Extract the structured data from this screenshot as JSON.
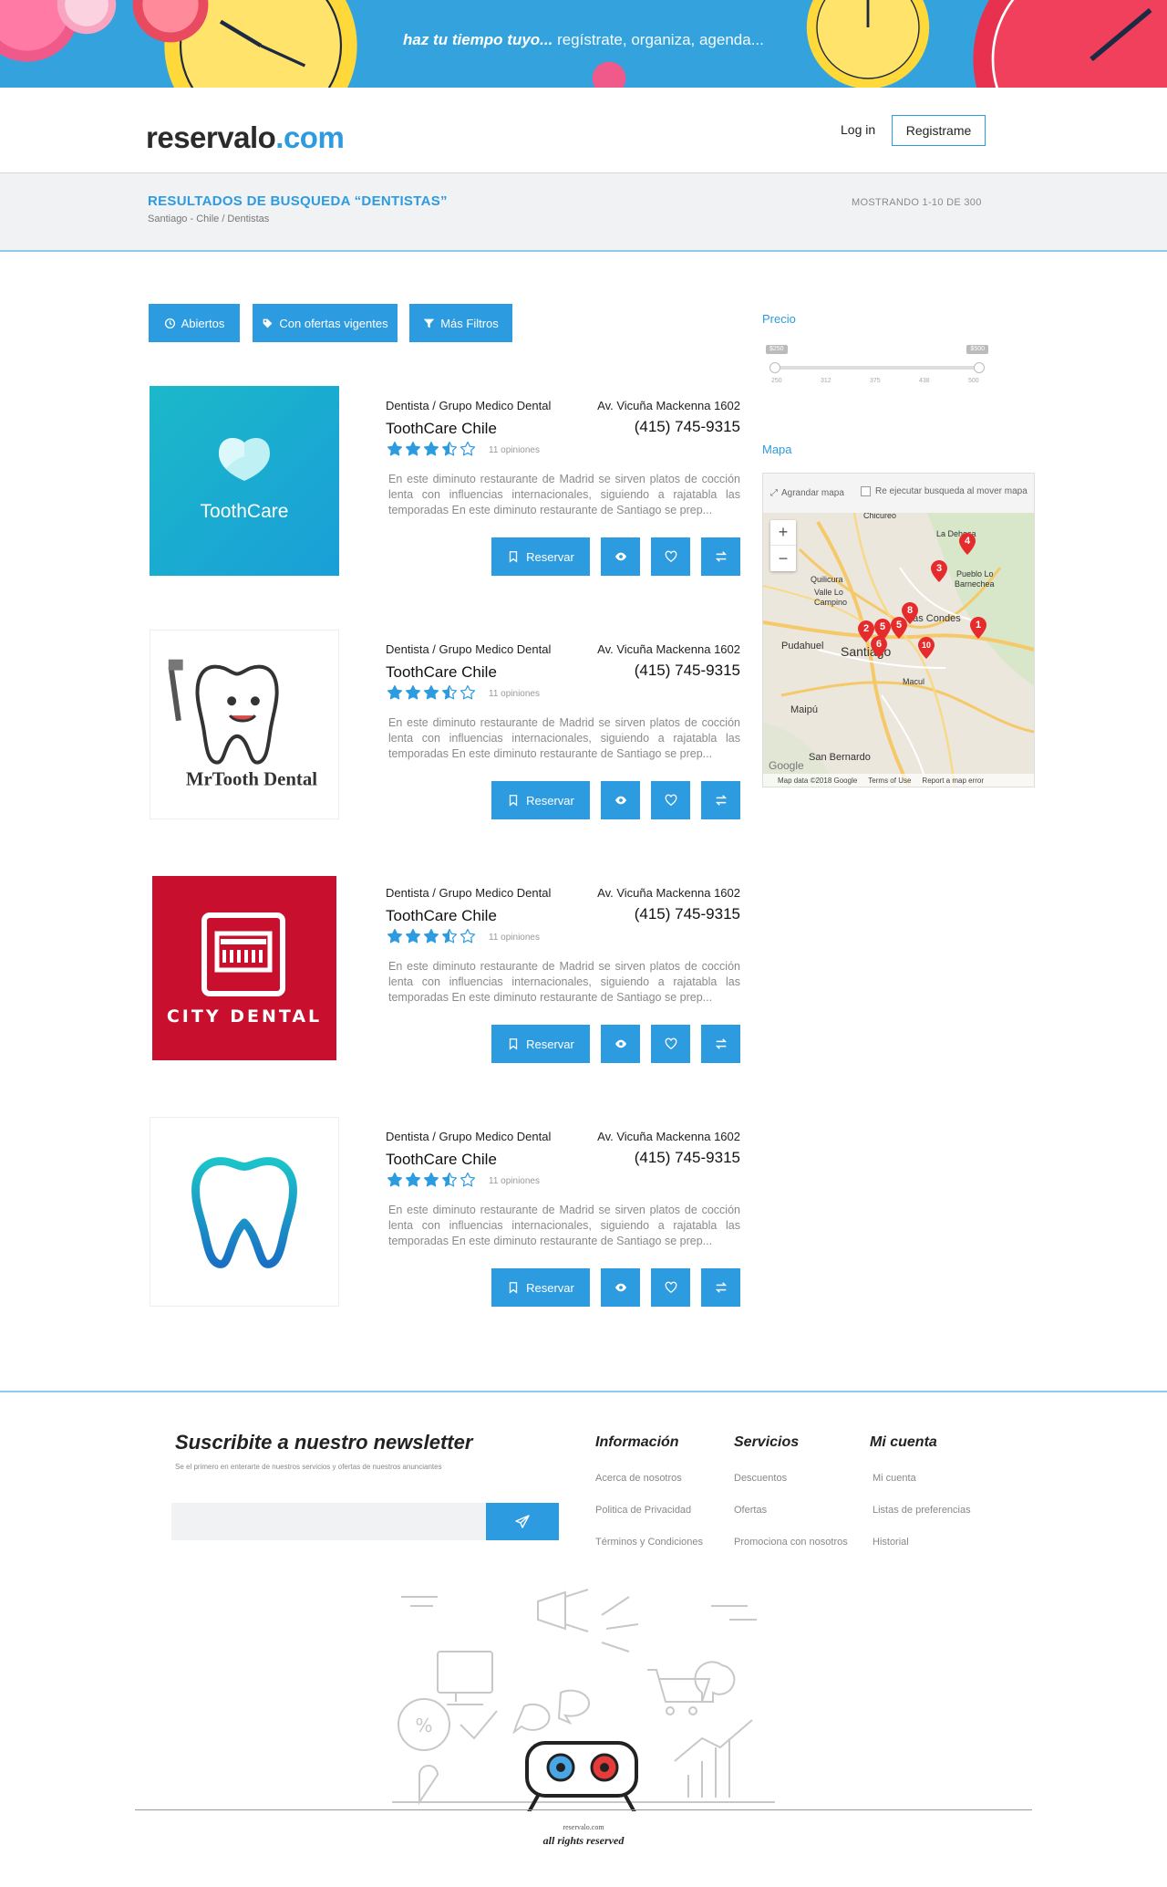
{
  "banner": {
    "slogan_bold": "haz tu tiempo tuyo...",
    "slogan_light": " regístrate, organiza, agenda..."
  },
  "header": {
    "logo_main": "reservalo",
    "logo_tld": ".com",
    "login_label": "Log in",
    "register_label": "Registrame"
  },
  "results": {
    "title": "RESULTADOS DE BUSQUEDA “DENTISTAS”",
    "breadcrumb": "Santiago - Chile / Dentistas",
    "showing": "MOSTRANDO 1-10 DE 300"
  },
  "filters": [
    {
      "label": "Abiertos",
      "icon": "clock-icon"
    },
    {
      "label": "Con ofertas vigentes",
      "icon": "tag-icon"
    },
    {
      "label": "Más Filtros",
      "icon": "filter-icon"
    }
  ],
  "listing_buttons": {
    "reserve_label": "Reservar"
  },
  "listings": [
    {
      "logo": "ToothCare",
      "category": "Dentista / Grupo Medico Dental",
      "address": "Av. Vicuña Mackenna 1602",
      "name": "ToothCare Chile",
      "phone": "(415) 745-9315",
      "rating": 3.5,
      "reviews": "11 opiniones",
      "description": "En este diminuto restaurante de Madrid se sirven platos de cocción lenta con influencias internacionales, siguiendo a rajatabla las temporadas En este diminuto restaurante de Santiago se prep..."
    },
    {
      "logo": "MrTooth Dental",
      "category": "Dentista / Grupo Medico Dental",
      "address": "Av. Vicuña Mackenna 1602",
      "name": "ToothCare Chile",
      "phone": "(415) 745-9315",
      "rating": 3.5,
      "reviews": "11 opiniones",
      "description": "En este diminuto restaurante de Madrid se sirven platos de cocción lenta con influencias internacionales, siguiendo a rajatabla las temporadas En este diminuto restaurante de Santiago se prep..."
    },
    {
      "logo": "CITY DENTAL",
      "category": "Dentista / Grupo Medico Dental",
      "address": "Av. Vicuña Mackenna 1602",
      "name": "ToothCare Chile",
      "phone": "(415) 745-9315",
      "rating": 3.5,
      "reviews": "11 opiniones",
      "description": "En este diminuto restaurante de Madrid se sirven platos de cocción lenta con influencias internacionales, siguiendo a rajatabla las temporadas En este diminuto restaurante de Santiago se prep..."
    },
    {
      "logo": "",
      "category": "Dentista / Grupo Medico Dental",
      "address": "Av. Vicuña Mackenna 1602",
      "name": "ToothCare Chile",
      "phone": "(415) 745-9315",
      "rating": 3.5,
      "reviews": "11 opiniones",
      "description": "En este diminuto restaurante de Madrid se sirven platos de cocción lenta con influencias internacionales, siguiendo a rajatabla las temporadas En este diminuto restaurante de Santiago se prep..."
    }
  ],
  "sidebar": {
    "price_label": "Precio",
    "price_min_badge": "$250",
    "price_max_badge": "$500",
    "price_ticks": [
      "250",
      "312",
      "375",
      "438",
      "500"
    ],
    "price_range": [
      250,
      500
    ],
    "map_label": "Mapa",
    "map_enlarge": "Agrandar mapa",
    "map_rerun": "Re ejecutar busqueda al mover mapa",
    "map_zoom_in": "+",
    "map_zoom_out": "−",
    "map_places": {
      "chicureo": "Chicureo",
      "la_dehesa": "La Dehesa",
      "pueblo_lo": "Pueblo Lo",
      "barnechea": "Barnechea",
      "quilicura": "Quilicura",
      "valle_lo": "Valle Lo",
      "campino": "Campino",
      "las_condes": "Las Condes",
      "pudahuel": "Pudahuel",
      "santiago": "Santiago",
      "macul": "Macul",
      "maipu": "Maipú",
      "san_bernardo": "San Bernardo"
    },
    "map_markers": [
      "1",
      "2",
      "3",
      "4",
      "5",
      "5",
      "6",
      "8",
      "10"
    ],
    "map_footer": [
      "Map data ©2018 Google",
      "Terms of Use",
      "Report a map error"
    ],
    "map_google": "Google"
  },
  "newsletter": {
    "title": "Suscribite a nuestro newsletter",
    "subtitle": "Se el primero en enterarte de nuestros servicios y ofertas de nuestros anunciantes",
    "input_value": ""
  },
  "footer": {
    "columns": [
      {
        "title": "Información",
        "links": [
          "Acerca de nosotros",
          "Politica de Privacidad",
          "Términos y Condiciones"
        ]
      },
      {
        "title": "Servicios",
        "links": [
          "Descuentos",
          "Ofertas",
          "Promociona con nosotros"
        ]
      },
      {
        "title": "Mi cuenta",
        "links": [
          "Mi cuenta",
          "Listas de preferencias",
          "Historial"
        ]
      }
    ],
    "illustration_percent": "%",
    "copyright_line1": "reservalo.com",
    "copyright_line2": "all rights reserved"
  },
  "colors": {
    "accent": "#2d9be0",
    "banner": "#34a3dd",
    "star": "#2d9be0",
    "city_dental": "#c8102e",
    "marker": "#e52b2b"
  }
}
